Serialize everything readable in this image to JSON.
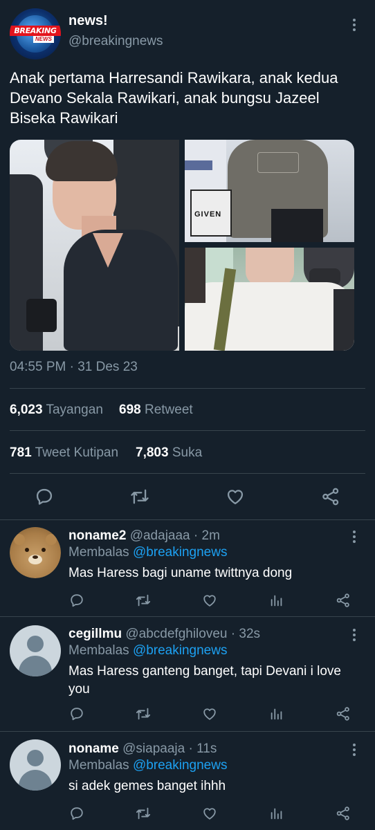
{
  "main_tweet": {
    "avatar": {
      "label_top": "BREAKING",
      "label_bottom": "NEWS"
    },
    "name": "news!",
    "handle": "@breakingnews",
    "text": "Anak pertama Harresandi Rawikara, anak kedua Devano Sekala Rawikari, anak bungsu Jazeel Biseka Rawikari",
    "images": [
      {
        "icon": "photo-person-black-shirt"
      },
      {
        "icon": "photo-grey-hoodie-givenchy-bag",
        "bag_text": "GIVEN"
      },
      {
        "icon": "photo-white-shirt"
      }
    ],
    "timestamp": "04:55 PM · 31 Des 23",
    "stats": {
      "views_count": "6,023",
      "views_label": "Tayangan",
      "retweets_count": "698",
      "retweets_label": "Retweet",
      "quotes_count": "781",
      "quotes_label": "Tweet Kutipan",
      "likes_count": "7,803",
      "likes_label": "Suka"
    },
    "actions": [
      "reply-icon",
      "retweet-icon",
      "like-icon",
      "share-icon"
    ]
  },
  "replies": [
    {
      "name": "noname2",
      "handle": "@adajaaa",
      "time": "· 2m",
      "replying_label": "Membalas",
      "replying_to": "@breakingnews",
      "text": "Mas Haress bagi uname twittnya dong",
      "avatar": "bear-avatar"
    },
    {
      "name": "cegillmu",
      "handle": "@abcdefghiloveu",
      "time": "· 32s",
      "replying_label": "Membalas",
      "replying_to": "@breakingnews",
      "text": "Mas Haress ganteng banget, tapi Devani i love you",
      "avatar": "default-avatar"
    },
    {
      "name": "noname",
      "handle": "@siapaaja",
      "time": "· 11s",
      "replying_label": "Membalas",
      "replying_to": "@breakingnews",
      "text": "si adek gemes banget ihhh",
      "avatar": "default-avatar"
    }
  ],
  "colors": {
    "background": "#15202b",
    "secondary_text": "#8899a6",
    "link": "#1da1f2",
    "divider": "#38444d"
  }
}
